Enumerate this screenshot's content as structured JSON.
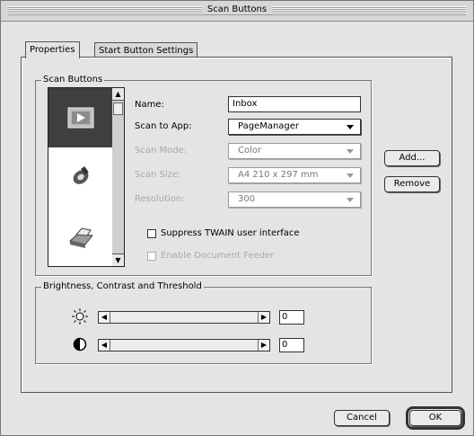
{
  "window": {
    "title": "Scan Buttons"
  },
  "tabs": [
    {
      "label": "Properties",
      "active": true
    },
    {
      "label": "Start Button Settings",
      "active": false
    }
  ],
  "scan_buttons_group": {
    "label": "Scan Buttons",
    "list_items": [
      {
        "icon": "scanner-icon",
        "selected": true
      },
      {
        "icon": "fax-icon",
        "selected": false
      },
      {
        "icon": "printer-icon",
        "selected": false
      }
    ],
    "fields": {
      "name_label": "Name:",
      "name_value": "Inbox",
      "scan_to_app_label": "Scan to App:",
      "scan_to_app_value": "PageManager",
      "scan_mode_label": "Scan Mode:",
      "scan_mode_value": "Color",
      "scan_size_label": "Scan Size:",
      "scan_size_value": "A4 210 x 297 mm",
      "resolution_label": "Resolution:",
      "resolution_value": "300"
    },
    "suppress_twain_label": "Suppress TWAIN user interface",
    "suppress_twain_checked": false,
    "enable_feeder_label": "Enable Document Feeder",
    "enable_feeder_checked": false
  },
  "side_buttons": {
    "add": "Add...",
    "remove": "Remove"
  },
  "bct_group": {
    "label": "Brightness, Contrast and Threshold",
    "brightness_value": "0",
    "contrast_value": "0",
    "brightness_icon": "sun-icon",
    "contrast_icon": "contrast-icon"
  },
  "footer": {
    "cancel": "Cancel",
    "ok": "OK"
  }
}
